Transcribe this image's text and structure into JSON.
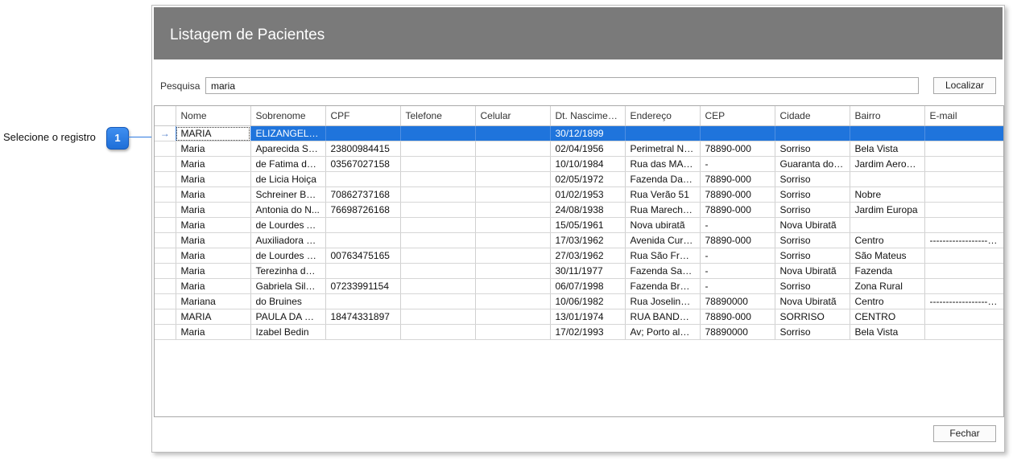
{
  "annotation": {
    "label": "Selecione o registro",
    "badge": "1"
  },
  "window": {
    "title": "Listagem de Pacientes"
  },
  "search": {
    "label": "Pesquisa",
    "value": "maria",
    "find_label": "Localizar"
  },
  "footer": {
    "close_label": "Fechar"
  },
  "colors": {
    "header": "#7a7a7a",
    "selection": "#1f74dc",
    "badge": "#2d7ae0"
  },
  "grid": {
    "selected_row": 0,
    "columns": [
      "Nome",
      "Sobrenome",
      "CPF",
      "Telefone",
      "Celular",
      "Dt. Nascimento",
      "Endereço",
      "CEP",
      "Cidade",
      "Bairro",
      "E-mail"
    ],
    "rows": [
      [
        "MARIA",
        "ELIZANGELA R...",
        "",
        "",
        "",
        "30/12/1899",
        "",
        "",
        "",
        "",
        ""
      ],
      [
        "Maria",
        "Aparecida So...",
        "23800984415",
        "",
        "",
        "02/04/1956",
        "Perimetral No...",
        "78890-000",
        "Sorriso",
        "Bela Vista",
        ""
      ],
      [
        "Maria",
        "de Fatima de ...",
        "03567027158",
        "",
        "",
        "10/10/1984",
        "Rua das MArg...",
        "   -",
        "Guaranta do ...",
        "Jardim Aerop...",
        ""
      ],
      [
        "Maria",
        "de Licia Hoiça",
        "",
        "",
        "",
        "02/05/1972",
        "Fazenda  Daroit",
        "78890-000",
        "Sorriso",
        "",
        ""
      ],
      [
        "Maria",
        "Schreiner Bedin",
        "70862737168",
        "",
        "",
        "01/02/1953",
        "Rua Verão 51",
        "78890-000",
        "Sorriso",
        "Nobre",
        ""
      ],
      [
        "Maria",
        "Antonia do N...",
        "76698726168",
        "",
        "",
        "24/08/1938",
        "Rua Marechal...",
        "78890-000",
        "Sorriso",
        "Jardim Europa",
        ""
      ],
      [
        "Maria",
        "de Lourdes Ac...",
        "",
        "",
        "",
        "15/05/1961",
        "Nova ubiratã",
        "   -",
        "Nova Ubiratã",
        "",
        ""
      ],
      [
        "Maria",
        "Auxiliadora D...",
        "",
        "",
        "",
        "17/03/1962",
        "Avenida Curiti...",
        "78890-000",
        "Sorriso",
        "Centro",
        "--------------------..."
      ],
      [
        "Maria",
        "de Lourdes Q...",
        "00763475165",
        "",
        "",
        "27/03/1962",
        "Rua São Fran...",
        "-",
        "Sorriso",
        "São Mateus",
        ""
      ],
      [
        "Maria",
        "Terezinha da ...",
        "",
        "",
        "",
        "30/11/1977",
        "Fazenda Sant...",
        "-",
        "Nova Ubiratã",
        "Fazenda",
        ""
      ],
      [
        "Maria",
        "Gabriela Silva ...",
        "07233991154",
        "",
        "",
        "06/07/1998",
        "Fazenda Bres...",
        "-",
        "Sorriso",
        "Zona Rural",
        ""
      ],
      [
        "Mariana",
        "do Bruines",
        "",
        "",
        "",
        "10/06/1982",
        "Rua Joselino ...",
        "78890000",
        "Nova Ubiratã",
        "Centro",
        "--------------------..."
      ],
      [
        "MARIA",
        "PAULA DA SIL...",
        "18474331897",
        "",
        "",
        "13/01/1974",
        "RUA BANDER...",
        "78890-000",
        "SORRISO",
        "CENTRO",
        ""
      ],
      [
        "Maria",
        "Izabel Bedin",
        "",
        "",
        "",
        "17/02/1993",
        "Av; Porto aleg...",
        "78890000",
        "Sorriso",
        "Bela Vista",
        ""
      ]
    ]
  }
}
